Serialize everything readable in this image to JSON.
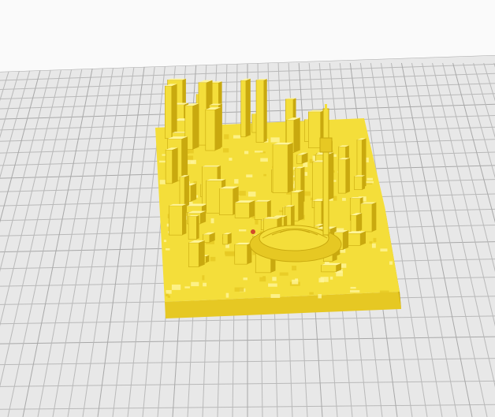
{
  "viewport": {
    "background": "#fafafa",
    "build_plate": {
      "surface": "#e8e8e8",
      "grid_line": "#b9b9b9",
      "grid_line_major": "#a8a8a8"
    },
    "model": {
      "kind": "3d-printed city terrain model",
      "fill": "#f4de3a",
      "shade_dark": "#c9a90f",
      "shade_mid": "#e6c823",
      "highlight": "#fff59a",
      "accent_red": "#d14b2a"
    }
  }
}
